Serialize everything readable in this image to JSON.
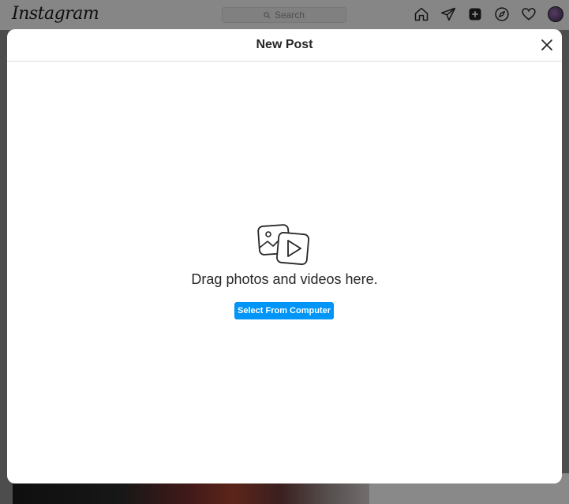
{
  "app": {
    "logo_text": "Instagram"
  },
  "search": {
    "placeholder": "Search"
  },
  "nav": {
    "icons": [
      "home-icon",
      "direct-message-icon",
      "new-post-icon",
      "explore-icon",
      "activity-heart-icon",
      "profile-avatar"
    ]
  },
  "modal": {
    "title": "New Post",
    "prompt": "Drag photos and videos here.",
    "select_button_label": "Select From Computer",
    "close_icon": "close-icon",
    "media_icon": "photo-video-icon"
  },
  "colors": {
    "accent": "#0095f6",
    "text": "#262626",
    "divider": "#dbdbdb"
  }
}
